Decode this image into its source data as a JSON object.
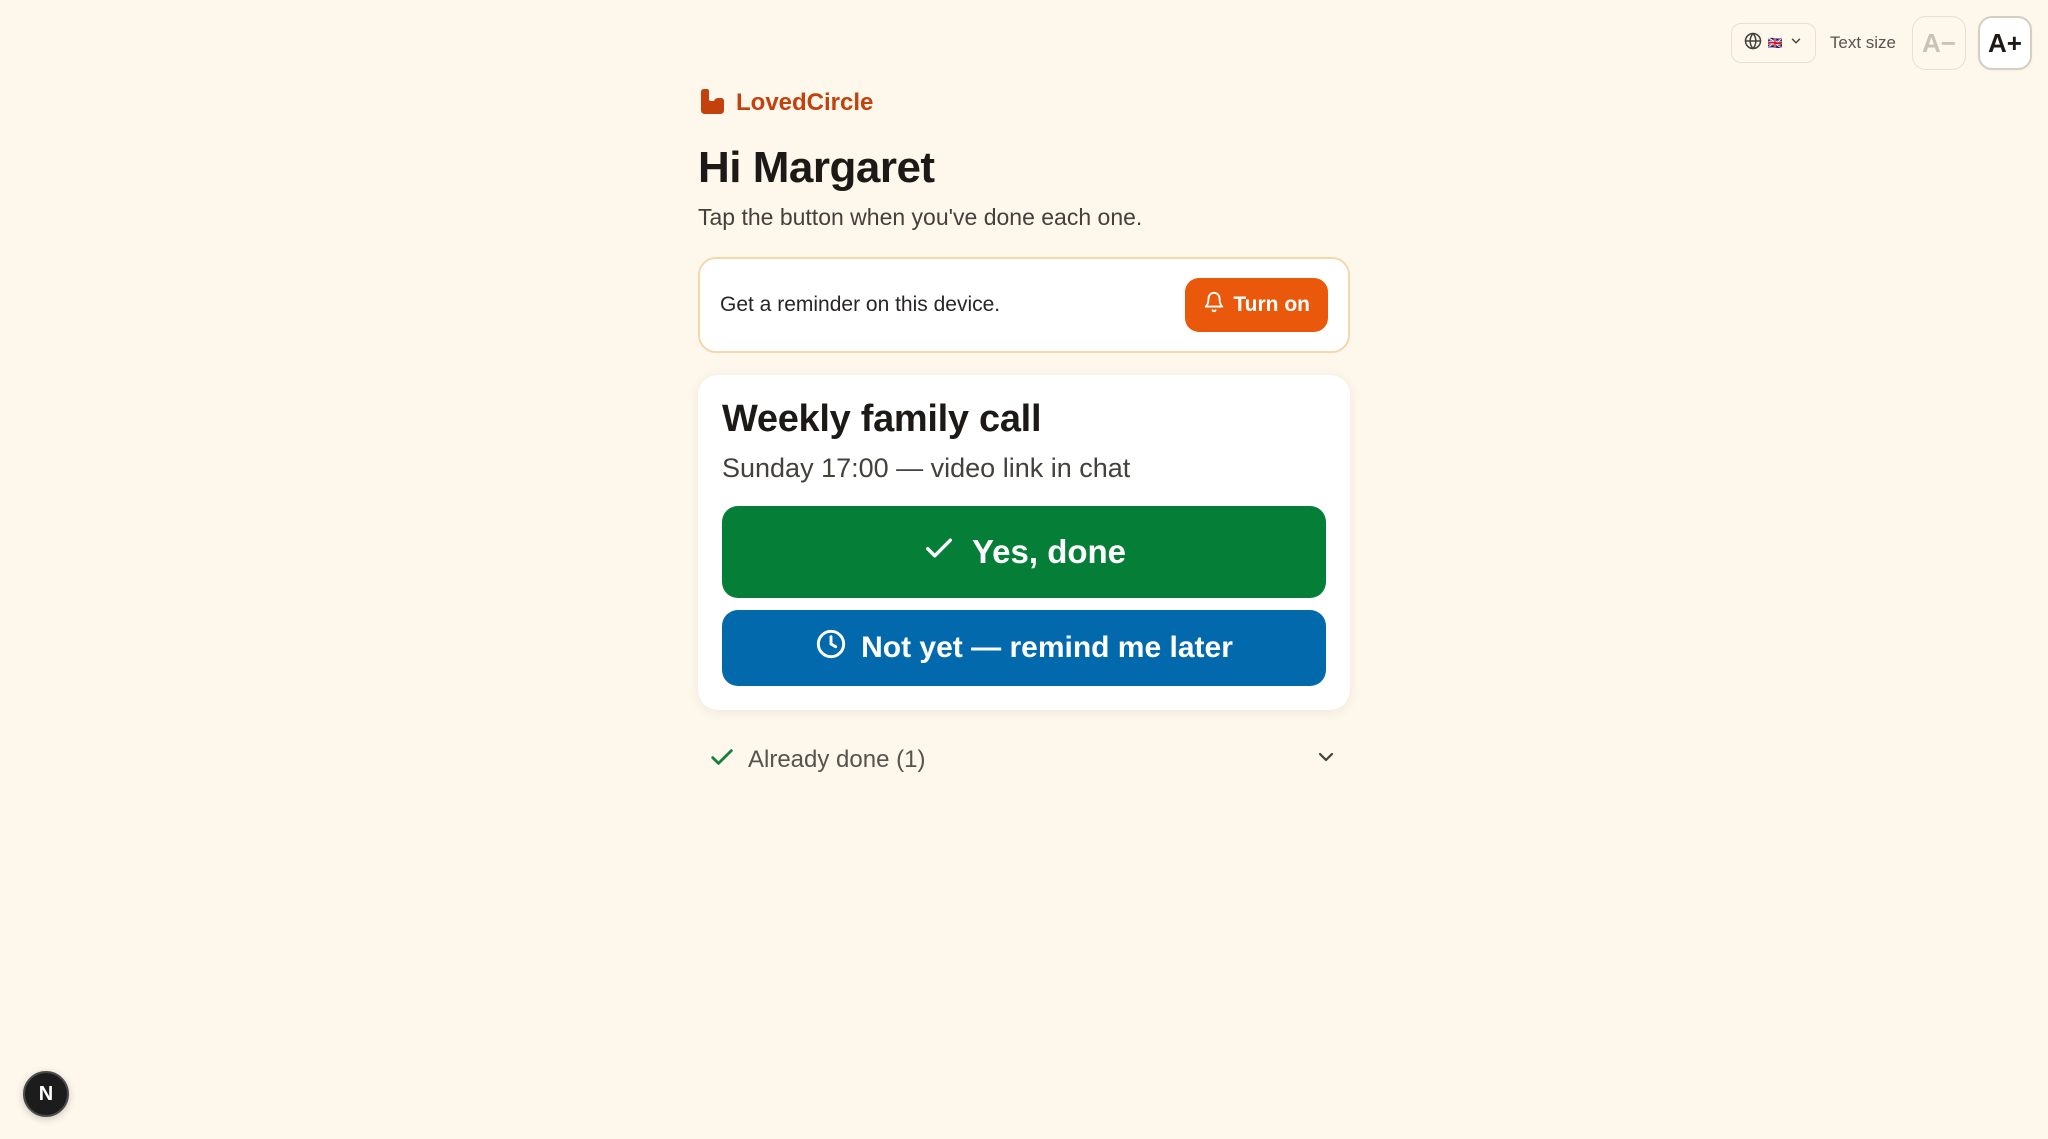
{
  "toolbar": {
    "language_flag": "🇬🇧",
    "text_size_label": "Text size",
    "decrease_label": "A−",
    "increase_label": "A+"
  },
  "brand": {
    "name": "LovedCircle",
    "color": "#c2410c"
  },
  "greeting": "Hi Margaret",
  "subtitle": "Tap the button when you've done each one.",
  "reminder": {
    "text": "Get a reminder on this device.",
    "button_label": "Turn on",
    "button_color": "#ea580c"
  },
  "task": {
    "title": "Weekly family call",
    "subtitle": "Sunday 17:00 — video link in chat",
    "done_label": "Yes, done",
    "done_color": "#057f37",
    "later_label": "Not yet — remind me later",
    "later_color": "#0369ad"
  },
  "already_done": {
    "label": "Already done (1)"
  },
  "dev_badge": {
    "letter": "N"
  }
}
